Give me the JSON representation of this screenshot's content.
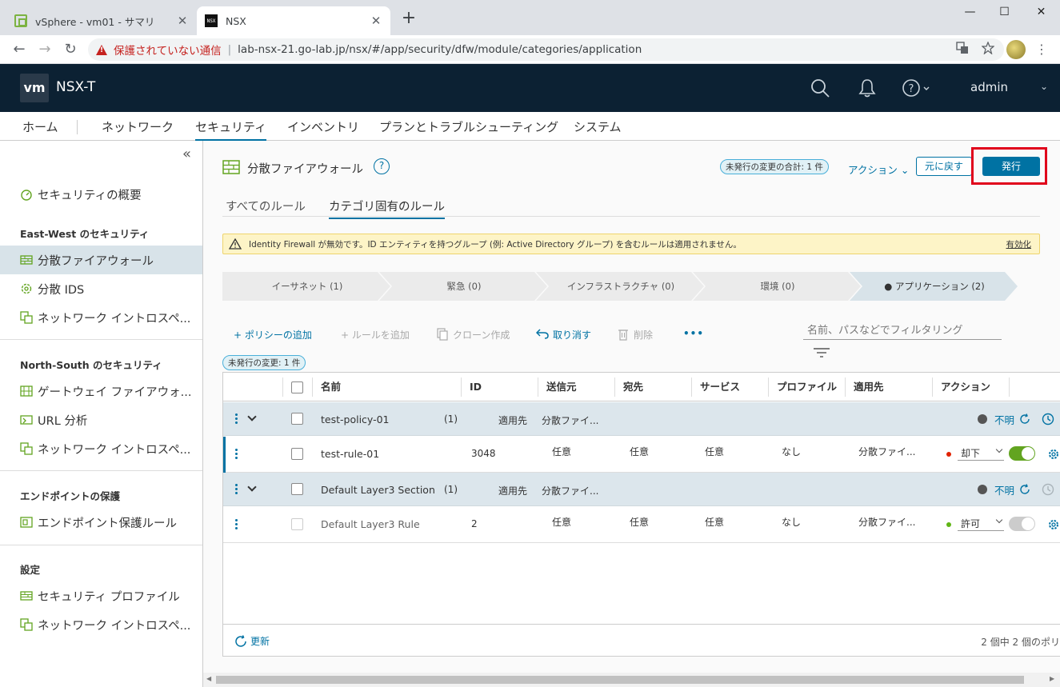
{
  "browser": {
    "tabs": [
      {
        "title": "vSphere - vm01 - サマリ",
        "close": "✕"
      },
      {
        "title": "NSX",
        "close": "✕",
        "favicon_text": "NSX"
      }
    ],
    "new_tab": "+",
    "window_controls": {
      "minimize": "—",
      "maximize": "☐",
      "close": "✕"
    },
    "nav": {
      "back": "←",
      "forward": "→",
      "reload": "↻"
    },
    "insecure_label": "保護されていない通信",
    "separator": "|",
    "url": "lab-nsx-21.go-lab.jp/nsx/#/app/security/dfw/module/categories/application"
  },
  "header": {
    "logo": "vm",
    "product": "NSX-T",
    "user": "admin"
  },
  "topnav": [
    "ホーム",
    "ネットワーク",
    "セキュリティ",
    "インベントリ",
    "プランとトラブルシューティング",
    "システム"
  ],
  "sidebar": {
    "collapse": "«",
    "overview": "セキュリティの概要",
    "sections": [
      {
        "heading": "East-West のセキュリティ",
        "items": [
          "分散ファイアウォール",
          "分散 IDS",
          "ネットワーク イントロスペ..."
        ]
      },
      {
        "heading": "North-South のセキュリティ",
        "items": [
          "ゲートウェイ ファイアウォ...",
          "URL 分析",
          "ネットワーク イントロスペ..."
        ]
      },
      {
        "heading": "エンドポイントの保護",
        "items": [
          "エンドポイント保護ルール"
        ]
      },
      {
        "heading": "設定",
        "items": [
          "セキュリティ プロファイル",
          "ネットワーク イントロスペ..."
        ]
      }
    ]
  },
  "main": {
    "title": "分散ファイアウォール",
    "help": "?",
    "pending_total": "未発行の変更の合計: 1 件",
    "actions": "アクション ⌄",
    "revert": "元に戻す",
    "publish": "発行",
    "subtabs": [
      "すべてのルール",
      "カテゴリ固有のルール"
    ],
    "alert": {
      "text": "Identity Firewall が無効です。ID エンティティを持つグループ (例: Active Directory グループ) を含むルールは適用されません。",
      "link": "有効化"
    },
    "categories": [
      "イーサネット (1)",
      "緊急 (0)",
      "インフラストラクチャ (0)",
      "環境 (0)",
      "● アプリケーション (2)"
    ],
    "toolbar": {
      "add_policy": "+ ポリシーの追加",
      "add_rule": "+ ルールを追加",
      "clone": "クローン作成",
      "undo": "取り消す",
      "delete": "削除",
      "more": "•••",
      "filter_placeholder": "名前、パスなどでフィルタリング"
    },
    "pending_changes": "未発行の変更: 1 件",
    "columns": [
      "名前",
      "ID",
      "送信元",
      "宛先",
      "サービス",
      "プロファイル",
      "適用先",
      "アクション"
    ],
    "rows": [
      {
        "type": "section",
        "name": "test-policy-01",
        "count": "(1)",
        "applied_label": "適用先",
        "applied": "分散ファイ...",
        "status": "不明"
      },
      {
        "type": "rule",
        "name": "test-rule-01",
        "id": "3048",
        "source": "任意",
        "dest": "任意",
        "service": "任意",
        "profile": "なし",
        "applied": "分散ファイ...",
        "action": "却下",
        "action_color": "#e12200",
        "enabled": true
      },
      {
        "type": "section",
        "name": "Default Layer3 Section",
        "count": "(1)",
        "applied_label": "適用先",
        "applied": "分散ファイ...",
        "status": "不明"
      },
      {
        "type": "rule",
        "name": "Default Layer3 Rule",
        "id": "2",
        "source": "任意",
        "dest": "任意",
        "service": "任意",
        "profile": "なし",
        "applied": "分散ファイ...",
        "action": "許可",
        "action_color": "#60b515",
        "enabled": false
      }
    ],
    "footer": {
      "refresh": "更新",
      "count": "2 個中 2 個のポリ"
    }
  }
}
